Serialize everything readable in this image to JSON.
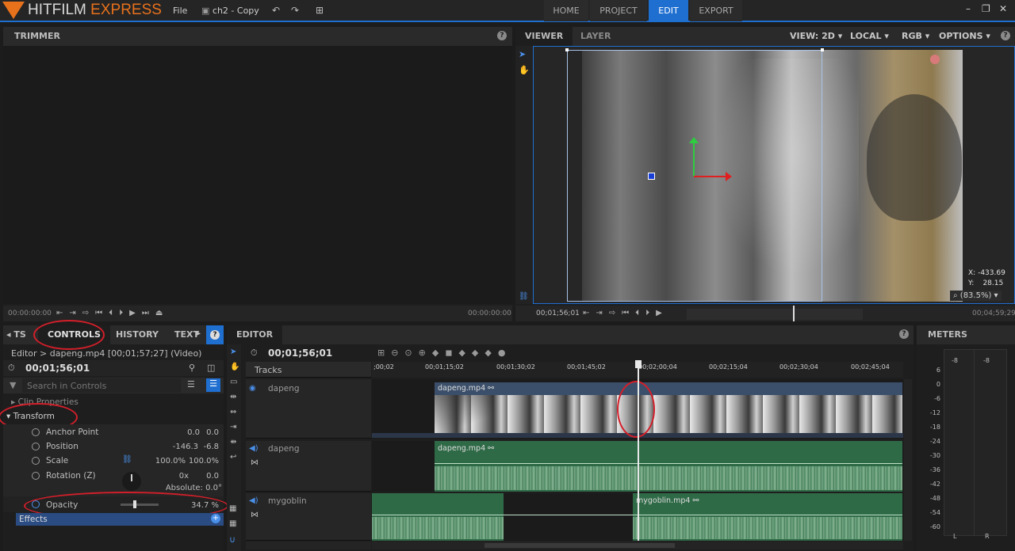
{
  "app": {
    "logo_main": "HITFILM",
    "logo_sub": "EXPRESS",
    "menu_file": "File",
    "project_name": "ch2 - Copy"
  },
  "nav": {
    "tabs": [
      "HOME",
      "PROJECT",
      "EDIT",
      "EXPORT"
    ],
    "active": "EDIT"
  },
  "trimmer": {
    "title": "TRIMMER",
    "timecode_start": "00:00:00:00",
    "timecode_end": "00:00:00:00"
  },
  "viewer": {
    "tabs": [
      "VIEWER",
      "LAYER"
    ],
    "view_mode": "VIEW: 2D",
    "space": "LOCAL",
    "channel": "RGB",
    "options": "OPTIONS",
    "coord_x_label": "X:",
    "coord_x": "-433.69",
    "coord_y_label": "Y:",
    "coord_y": "28.15",
    "zoom": "(83.5%)",
    "timecode_current": "00;01;56;01",
    "timecode_end": "00;04;59;29"
  },
  "left_panel": {
    "tabs": [
      "TS",
      "CONTROLS",
      "HISTORY",
      "TEXT"
    ],
    "active": "CONTROLS",
    "breadcrumb": "Editor > dapeng.mp4 [00;01;57;27] (Video)",
    "timecode": "00;01;56;01",
    "search_placeholder": "Search in Controls",
    "clip_properties": "Clip Properties",
    "transform": "Transform",
    "rows": [
      {
        "label": "Anchor Point",
        "v1": "0.0",
        "v2": "0.0"
      },
      {
        "label": "Position",
        "v1": "-146.3",
        "v2": "-6.8"
      },
      {
        "label": "Scale",
        "v1": "100.0%",
        "v2": "100.0%"
      },
      {
        "label": "Rotation (Z)",
        "v1": "0x",
        "v2": "0.0"
      }
    ],
    "absolute": "Absolute: 0.0°",
    "opacity_label": "Opacity",
    "opacity_value": "34.7 %",
    "opacity_level": 0.347,
    "effects": "Effects"
  },
  "editor": {
    "title": "EDITOR",
    "timecode": "00;01;56;01",
    "tracks_label": "Tracks",
    "ruler": [
      ";00;02",
      "00;01;15;02",
      "00;01;30;02",
      "00;01;45;02",
      "00;02;00;04",
      "00;02;15;04",
      "00;02;30;04",
      "00;02;45;04"
    ],
    "video_track": {
      "name": "dapeng",
      "clip": "dapeng.mp4"
    },
    "audio_tracks": [
      {
        "name": "dapeng",
        "clip": "dapeng.mp4"
      },
      {
        "name": "mygoblin",
        "clip": "mygoblin.mp4"
      }
    ]
  },
  "meters": {
    "title": "METERS",
    "peak_l": "-8",
    "peak_r": "-8",
    "scale": [
      "6",
      "0",
      "-6",
      "-12",
      "-18",
      "-24",
      "-30",
      "-36",
      "-42",
      "-48",
      "-54",
      "-60"
    ],
    "ch_l": "L",
    "ch_r": "R"
  },
  "colors": {
    "accent": "#1f6fd1",
    "logo_orange": "#e8711c",
    "annotation_red": "#d31f2a",
    "audio_green": "#2f6a47",
    "clip_blue": "#3b4f6a"
  }
}
